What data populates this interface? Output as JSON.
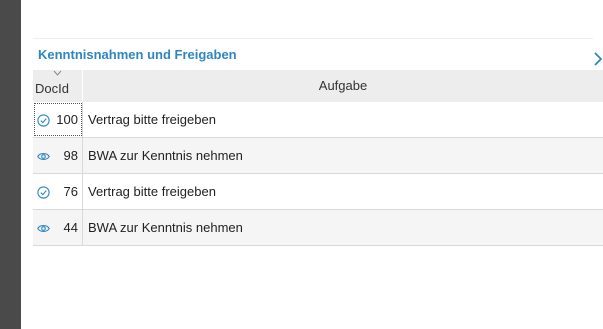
{
  "panel": {
    "title": "Kenntnisnahmen und Freigaben"
  },
  "table": {
    "columns": {
      "docid": "DocId",
      "aufgabe": "Aufgabe"
    },
    "rows": [
      {
        "id": "100",
        "task": "Vertrag bitte freigeben",
        "icon": "check-circle-icon"
      },
      {
        "id": "98",
        "task": "BWA zur Kenntnis nehmen",
        "icon": "eye-icon"
      },
      {
        "id": "76",
        "task": "Vertrag bitte freigeben",
        "icon": "check-circle-icon"
      },
      {
        "id": "44",
        "task": "BWA zur Kenntnis nehmen",
        "icon": "eye-icon"
      }
    ]
  },
  "colors": {
    "accent": "#2e86c1",
    "sidebar": "#4a4a4a",
    "header_bg": "#ededed",
    "alt_row": "#f5f5f5"
  }
}
